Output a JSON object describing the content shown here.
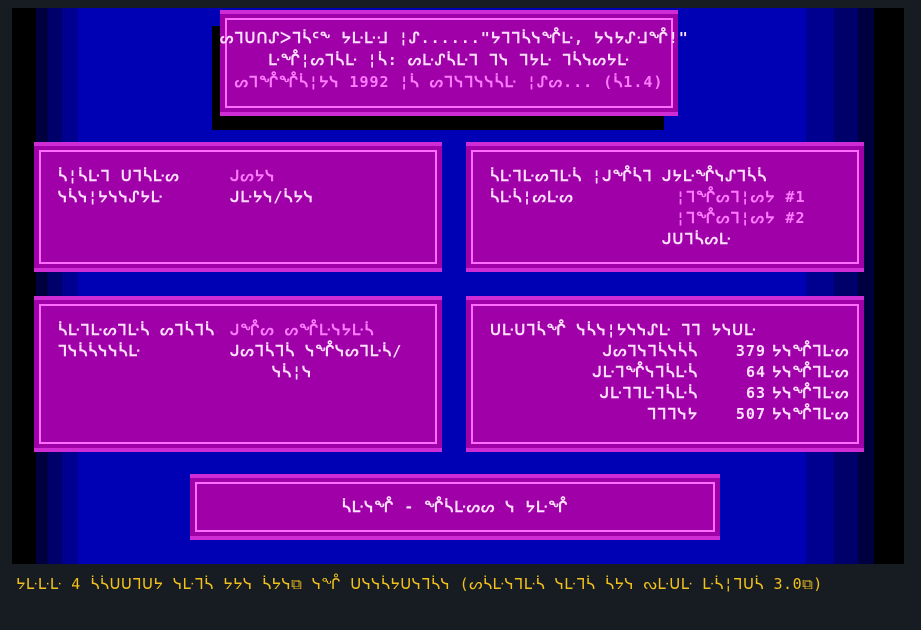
{
  "colors": {
    "panel_fill": "#a000a8",
    "panel_border": "#ff6cff",
    "text_white": "#ffe0ff",
    "text_magenta": "#ff7cff",
    "footer_text": "#f2c21c",
    "background_blue": "#0000b4"
  },
  "title_panel": {
    "line1": "ᔕᒣᑌᑎᔑᐳᒣᓵᑦᖕ ᔭᒷᒷᒲ ¦ᔑ......\"ᔭᒣᒣᓵᓭᖎᒷ, ᔭᓭᔭᔑᒲᖎ!\"",
    "line2": "ᒷᖎ¦ᔕᒣᓵᒷ ¦ᓵ: ᔕᒷᔑᓵᒷᒣ ᒣᓭ ᒣᔭᒷ ᒣᓵᓭᔕᔭᒷ",
    "line3": "ᔕᒣᖎᖎᓵ¦ᔭᓭ 1992 ¦ᓵ ᔕᒣᓭᒣᓭᓭᓵᒷ ¦ᔑᔕ... (ᓵ1.4)"
  },
  "panel_top_left": {
    "row1_label": "ᓵ¦ᓵᒷᒣ ᑌᒣᓵᒷᔕ",
    "row1_value": "ᒍᔕᔭᓭ",
    "row2_label": "ᓭᓵᓭ¦ᔭᓭᓭᔑᔭᒷ",
    "row2_value": "ᒍᒷᔭᓭ/ᓵᔭᓭ"
  },
  "panel_top_right": {
    "label1": "ᓵᒷᒣᒷᔕᒣᒷᓵ ¦ᒍᖎᓵᒣ",
    "label2": "ᓵᒷᓵ¦ᔕᒷᔕ",
    "value1": "ᒍᔭᒷᖎᓭᔑᒣᓵᓵ",
    "value2": "¦ᒣᖎᔕᒣ¦ᔕᔭ #1",
    "value3": "¦ᒣᖎᔕᒣ¦ᔕᔭ #2",
    "value4": "ᒍᑌᒣᓵᔕᒷ"
  },
  "panel_bottom_left": {
    "row1_label": "ᓵᒷᒣᒷᔕᒣᒷᓵ ᔕᒣᓵᒣᓵ",
    "row1_value": "ᒍᖎᔕ ᔕᖎᒷᓭᔭᒷᓵ",
    "row2_label": "ᒣᓭᓵᓵᓭᓭᓵᒷ",
    "row2_value": "ᒍᔕᒣᓵᒣᓵ ᓭᖎᓭᔕᒣᒷᓵ/",
    "row3_value": "ᓭᓵ¦ᓭ"
  },
  "panel_bottom_right": {
    "heading": "ᑌᒷᑌᒣᓵᖎ ᓭᓵᓭ¦ᔭᓭᓭᔑᒷ ᒣᒣ ᔭᓭᑌᒷ",
    "rows": [
      {
        "label": "ᒍᔕᒣᓭᒣᓵᓭᓵᓵ",
        "value": "379",
        "unit": "ᔭᓭᖎᒣᒷᔕ"
      },
      {
        "label": "ᒍᒷᒣᖎᓭᒣᓵᒷᓵ",
        "value": "64",
        "unit": "ᔭᓭᖎᒣᒷᔕ"
      },
      {
        "label": "ᒍᒷᒣᒣᒷᒣᓵᒷᓵ",
        "value": "63",
        "unit": "ᔭᓭᖎᒣᒷᔕ"
      },
      {
        "label": "ᒣᒣᒣᓭᔭ",
        "value": "507",
        "unit": "ᔭᓭᖎᒣᒷᔕ"
      }
    ]
  },
  "bottom_panel": {
    "label": "ᓵᒷᓭᖎ - ᖎᓵᒷᔕᔕ ᓭ ᔭᒷᖎ"
  },
  "footer": {
    "text": "ᔭᒷᒷᒷ 4 ᓵᓵᑌᑌᒣᑌᔭ ᓭᒷᒣᓵ ᔭᔭᓭ ᓵᔭᓭ⧉ ᓭᖎ ᑌᓭᓭᓵᔭᑌᓭᒣᓵᓭ (ᔕᓵᒷᓭᒣᒷᓵ ᓭᒷᒣᓵ ᓵᔭᓭ ᔓᒷᑌᒷ ᒷᓵ¦ᒣᑌᓵ 3.0⧉)"
  }
}
